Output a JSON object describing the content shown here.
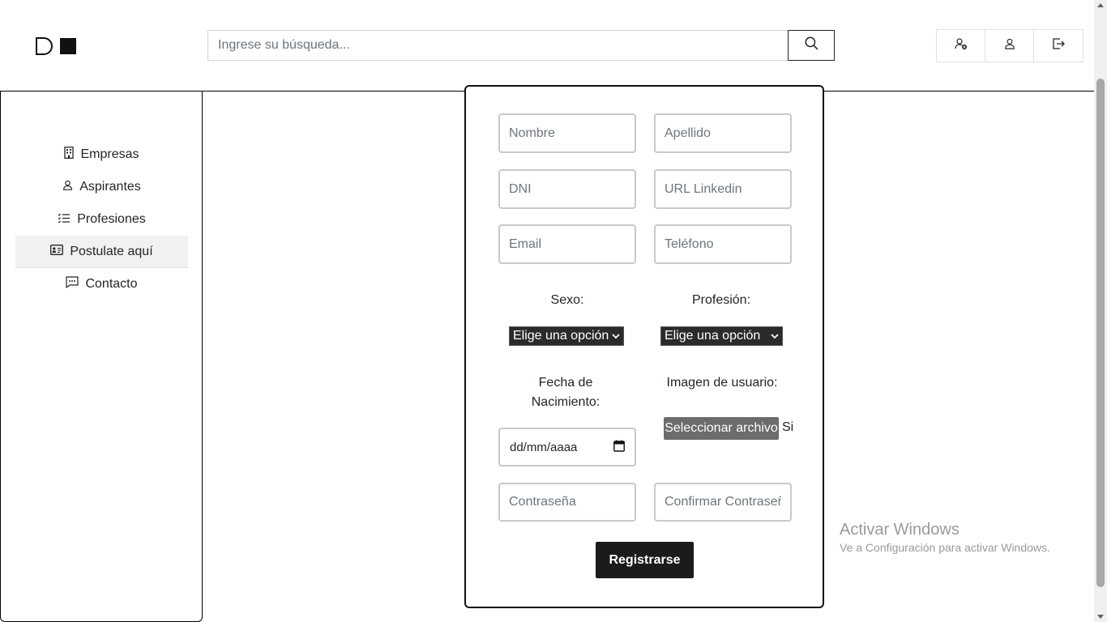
{
  "header": {
    "logo_name": "logo",
    "search": {
      "placeholder": "Ingrese su búsqueda...",
      "value": ""
    },
    "search_icon": "search-icon",
    "actions": [
      {
        "name": "register-user-icon"
      },
      {
        "name": "user-icon"
      },
      {
        "name": "logout-icon"
      }
    ]
  },
  "sidebar": {
    "items": [
      {
        "label": "Empresas",
        "icon": "building-icon",
        "active": false
      },
      {
        "label": "Aspirantes",
        "icon": "person-icon",
        "active": false
      },
      {
        "label": "Profesiones",
        "icon": "list-icon",
        "active": false
      },
      {
        "label": "Postulate aquí",
        "icon": "id-card-icon",
        "active": true
      },
      {
        "label": "Contacto",
        "icon": "chat-icon",
        "active": false
      }
    ]
  },
  "form": {
    "nombre_placeholder": "Nombre",
    "apellido_placeholder": "Apellido",
    "dni_placeholder": "DNI",
    "linkedin_placeholder": "URL Linkedin",
    "email_placeholder": "Email",
    "telefono_placeholder": "Teléfono",
    "sexo_label": "Sexo:",
    "sexo_value": "Elige una opción",
    "profesion_label": "Profesión:",
    "profesion_value": "Elige una opción",
    "fecha_label": "Fecha de Nacimiento:",
    "fecha_value": "dd/mm/aaaa",
    "imagen_label": "Imagen de usuario:",
    "file_button": "Seleccionar archivo",
    "file_status": "Si",
    "password_placeholder": "Contraseña",
    "confirm_password_placeholder": "Confirmar Contraseña",
    "submit_label": "Registrarse"
  },
  "watermark": {
    "title": "Activar Windows",
    "subtitle": "Ve a Configuración para activar Windows."
  }
}
